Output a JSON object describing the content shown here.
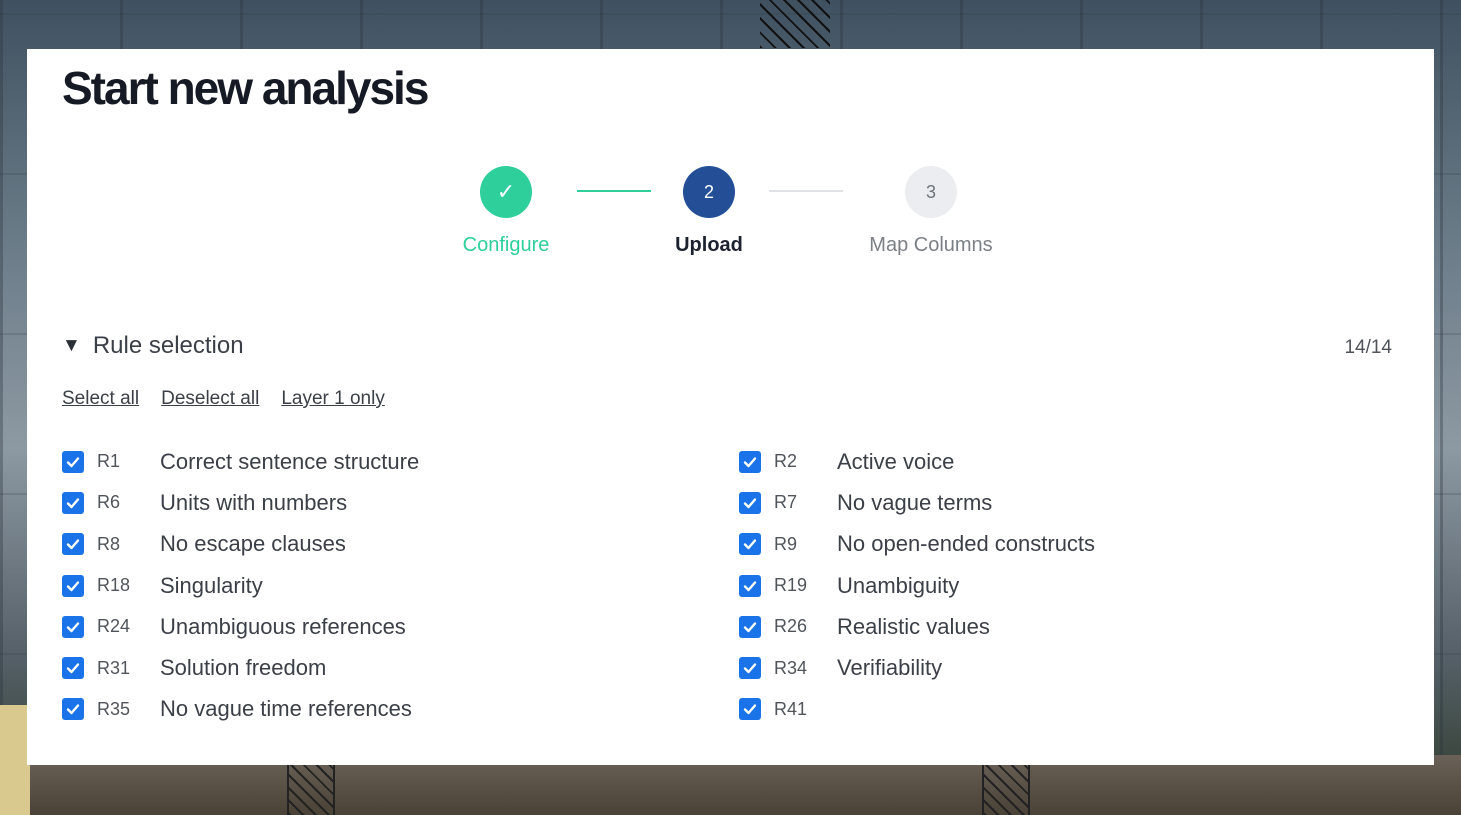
{
  "title": "Start new analysis",
  "steps": [
    {
      "label": "Configure",
      "marker": "✓",
      "status": "completed"
    },
    {
      "label": "Upload",
      "marker": "2",
      "status": "active"
    },
    {
      "label": "Map Columns",
      "marker": "3",
      "status": "pending"
    }
  ],
  "rule_section": {
    "title": "Rule selection",
    "counter": "14/14",
    "actions": {
      "select_all": "Select all",
      "deselect_all": "Deselect all",
      "layer_1_only": "Layer 1 only"
    },
    "left_rules": [
      {
        "id": "R1",
        "name": "Correct sentence structure",
        "checked": true
      },
      {
        "id": "R6",
        "name": "Units with numbers",
        "checked": true
      },
      {
        "id": "R8",
        "name": "No escape clauses",
        "checked": true
      },
      {
        "id": "R18",
        "name": "Singularity",
        "checked": true
      },
      {
        "id": "R24",
        "name": "Unambiguous references",
        "checked": true
      },
      {
        "id": "R31",
        "name": "Solution freedom",
        "checked": true
      },
      {
        "id": "R35",
        "name": "No vague time references",
        "checked": true
      }
    ],
    "right_rules": [
      {
        "id": "R2",
        "name": "Active voice",
        "checked": true
      },
      {
        "id": "R7",
        "name": "No vague terms",
        "checked": true
      },
      {
        "id": "R9",
        "name": "No open-ended constructs",
        "checked": true
      },
      {
        "id": "R19",
        "name": "Unambiguity",
        "checked": true
      },
      {
        "id": "R26",
        "name": "Realistic values",
        "checked": true
      },
      {
        "id": "R34",
        "name": "Verifiability",
        "checked": true
      },
      {
        "id": "R41",
        "name": "",
        "checked": true
      }
    ]
  },
  "colors": {
    "completed": "#2ecf9a",
    "active": "#244f96",
    "checkbox": "#1a73e8"
  },
  "icons": {
    "collapse": "caret-down-icon",
    "checkbox": "checkmark-icon",
    "completed_step": "checkmark-icon"
  }
}
